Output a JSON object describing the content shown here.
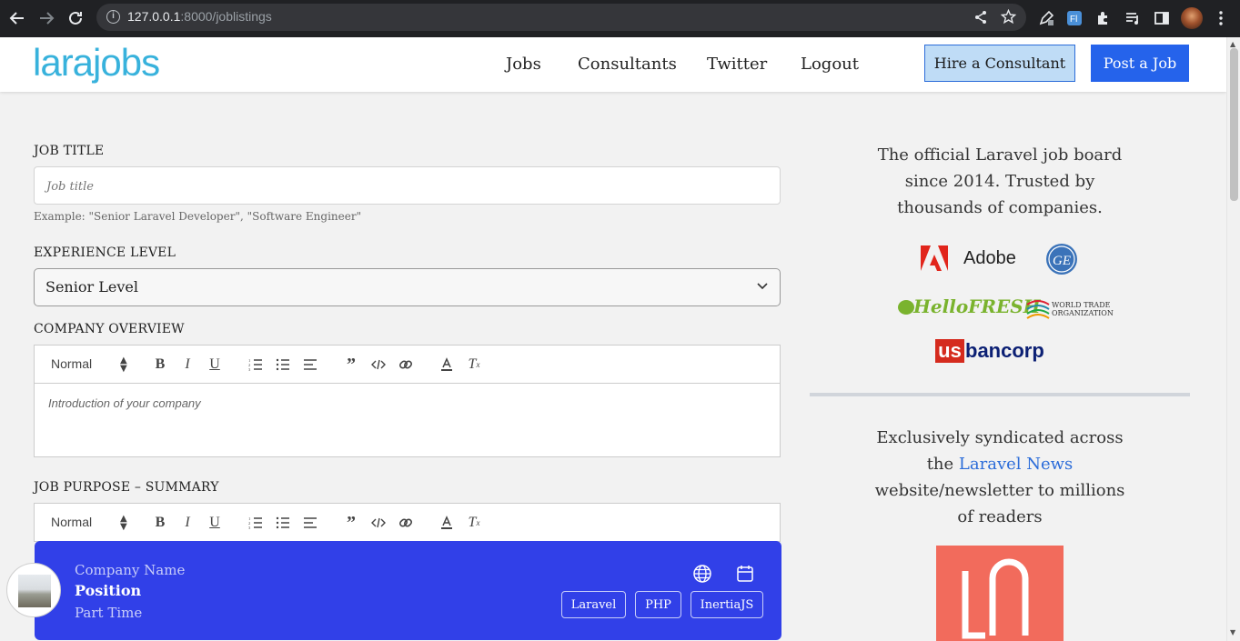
{
  "browser": {
    "url_host": "127.0.0.1",
    "url_path": ":8000/joblistings"
  },
  "header": {
    "logo": "larajobs",
    "nav": [
      "Jobs",
      "Consultants",
      "Twitter",
      "Logout"
    ],
    "hire_button": "Hire a Consultant",
    "post_button": "Post a Job"
  },
  "form": {
    "job_title_label": "JOB TITLE",
    "job_title_placeholder": "Job title",
    "job_title_hint": "Example: \"Senior Laravel Developer\", \"Software Engineer\"",
    "experience_label": "EXPERIENCE LEVEL",
    "experience_value": "Senior Level",
    "company_overview_label": "COMPANY OVERVIEW",
    "editor_format": "Normal",
    "company_overview_placeholder": "Introduction of your company",
    "job_purpose_label": "JOB PURPOSE – SUMMARY"
  },
  "preview": {
    "company_name": "Company Name",
    "position": "Position",
    "job_type": "Part Time",
    "tags": [
      "Laravel",
      "PHP",
      "InertiaJS"
    ]
  },
  "sidebar": {
    "intro_line1": "The official Laravel job board",
    "intro_line2": "since 2014. Trusted by",
    "intro_line3": "thousands of companies.",
    "brands": {
      "adobe": "Adobe",
      "hellofresh": "HelloFRESH",
      "wto_line1": "WORLD TRADE",
      "wto_line2": "ORGANIZATION",
      "usbancorp_us": "us",
      "usbancorp_rest": "bancorp"
    },
    "syndicated_line1": "Exclusively syndicated across",
    "syndicated_the": "the",
    "syndicated_link": "Laravel News",
    "syndicated_line3": "website/newsletter to millions",
    "syndicated_line4": "of readers"
  },
  "icons": {
    "back": "arrow-left-icon",
    "forward": "arrow-right-icon",
    "reload": "reload-icon",
    "globe": "globe-icon",
    "calendar": "calendar-icon"
  },
  "colors": {
    "accent": "#2563eb",
    "logo": "#38b2dc",
    "card": "#3140e8",
    "laravel_news": "#f26b5c"
  }
}
